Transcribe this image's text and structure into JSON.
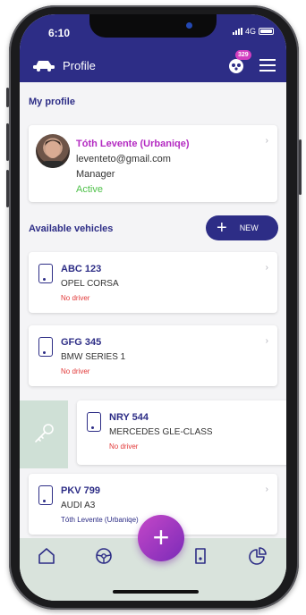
{
  "status_bar": {
    "time": "6:10",
    "network": "4G"
  },
  "app_bar": {
    "title": "Profile",
    "notification_count": "329"
  },
  "profile": {
    "section_title": "My profile",
    "name": "Tóth Levente (Urbaniqe)",
    "email": "leventeto@gmail.com",
    "role": "Manager",
    "status": "Active"
  },
  "vehicles": {
    "section_title": "Available vehicles",
    "new_label": "NEW",
    "items": [
      {
        "plate": "ABC 123",
        "model": "OPEL CORSA",
        "driver": "No driver"
      },
      {
        "plate": "GFG 345",
        "model": "BMW SERIES 1",
        "driver": "No driver"
      },
      {
        "plate": "NRY 544",
        "model": "MERCEDES GLE-CLASS",
        "driver": "No driver"
      },
      {
        "plate": "PKV 799",
        "model": "AUDI A3",
        "driver": "Tóth Levente (Urbaniqe)"
      }
    ]
  },
  "colors": {
    "primary": "#2d2d86",
    "accent": "#b42bc2",
    "active": "#4fc14a",
    "no_driver": "#e23a3a",
    "tabbar": "#d9e3dc"
  },
  "icons": {
    "bottom_nav": [
      "home-icon",
      "steering-wheel-icon",
      "add-icon",
      "phone-car-icon",
      "pie-chart-icon"
    ],
    "appbar": [
      "car-logo-icon",
      "notification-icon",
      "menu-icon"
    ]
  }
}
